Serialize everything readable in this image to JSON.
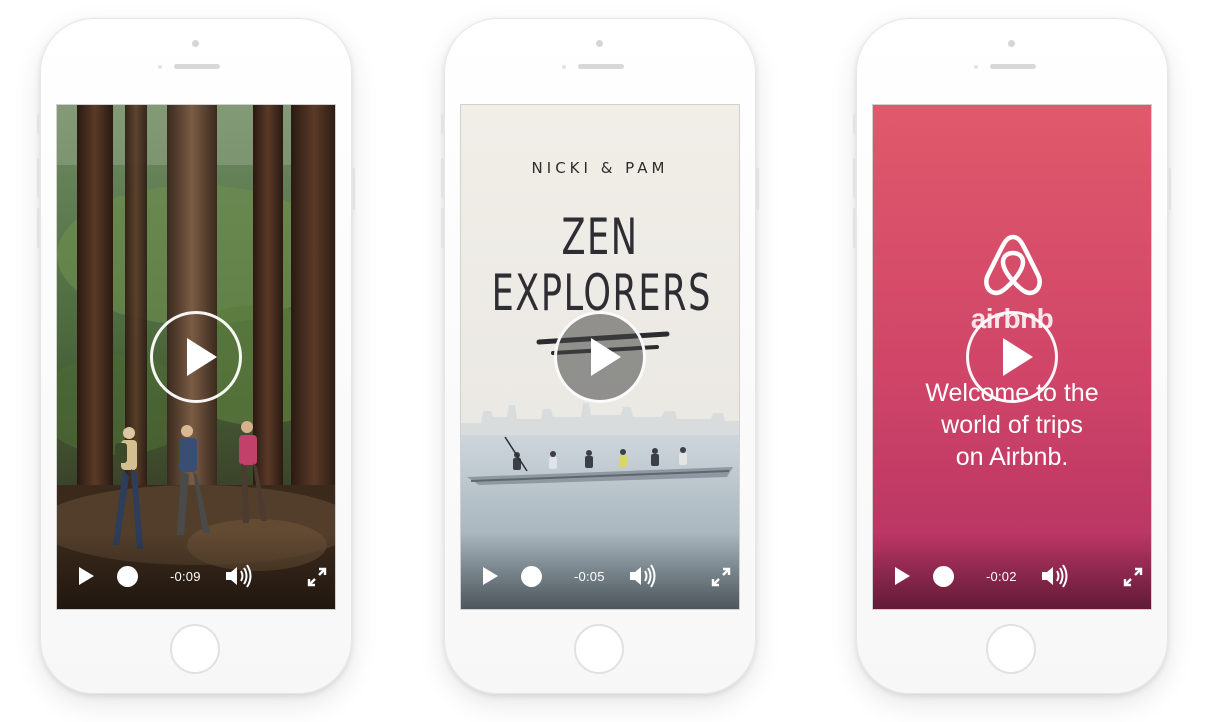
{
  "videos": [
    {
      "id": "forest",
      "time_remaining": "-0:09"
    },
    {
      "id": "zen",
      "subtitle": "NICKI & PAM",
      "title": "ZEN\nEXPLORERS",
      "time_remaining": "-0:05"
    },
    {
      "id": "airbnb",
      "brand": "airbnb",
      "welcome_text": "Welcome to the\nworld of trips\non Airbnb.",
      "time_remaining": "-0:02"
    }
  ],
  "colors": {
    "airbnb_gradient_top": "#e0596b",
    "airbnb_gradient_bottom": "#b93467",
    "zen_sky": "#efece6",
    "zen_water": "#b9c9d2",
    "forest_dark": "#2e2118"
  },
  "icons": [
    "play-icon",
    "volume-icon",
    "fullscreen-icon",
    "airbnb-logo-icon"
  ]
}
